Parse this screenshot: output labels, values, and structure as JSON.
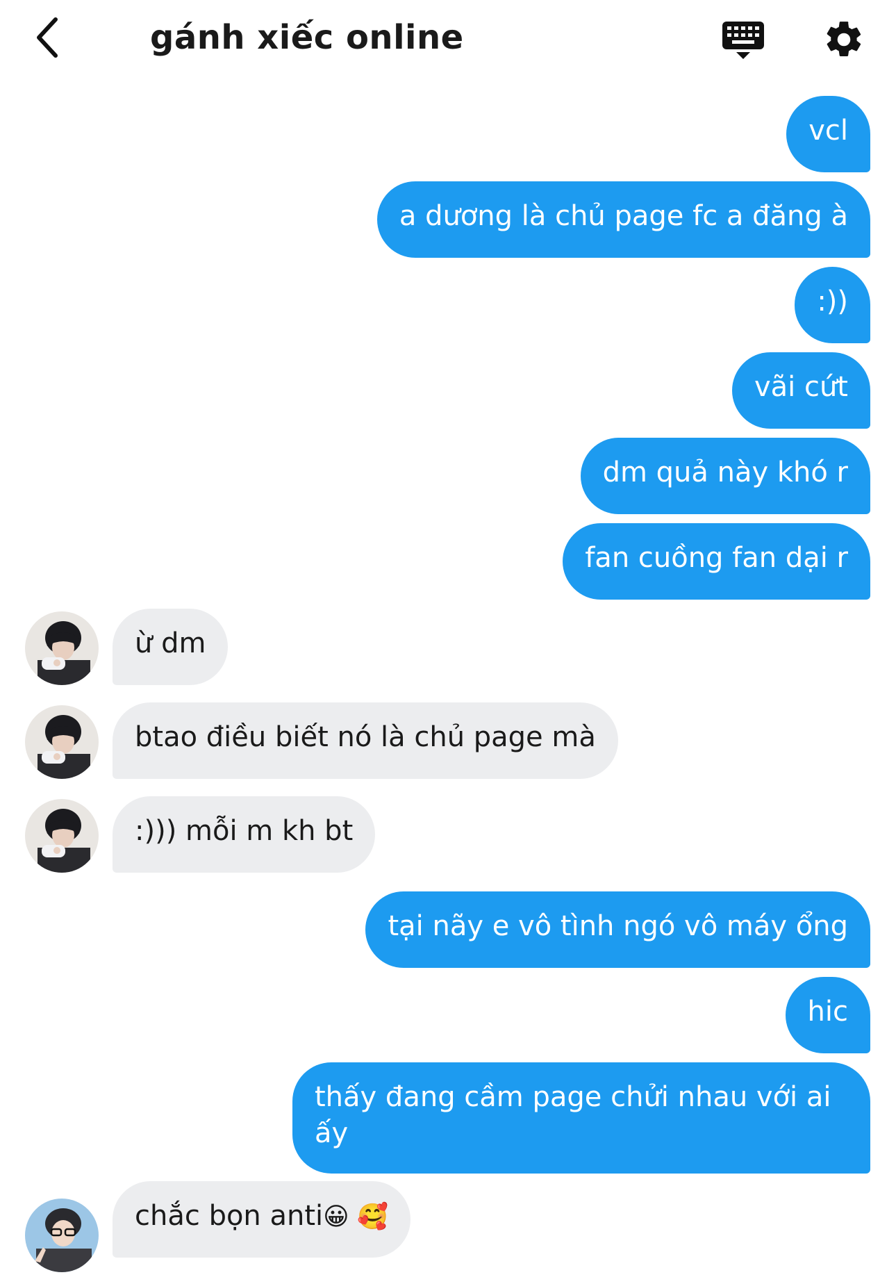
{
  "header": {
    "title": "gánh xiếc online",
    "back_icon": "chevron-left-icon",
    "keyboard_icon": "keyboard-icon",
    "settings_icon": "gear-icon"
  },
  "colors": {
    "outgoing_bubble": "#1d9bf0",
    "incoming_bubble": "#ecedef",
    "outgoing_text": "#ffffff",
    "incoming_text": "#1a1a1a"
  },
  "messages": [
    {
      "from": "me",
      "text": "vcl"
    },
    {
      "from": "me",
      "text": "a dương là chủ page fc a đăng à"
    },
    {
      "from": "me",
      "text": ":))"
    },
    {
      "from": "me",
      "text": "vãi cứt"
    },
    {
      "from": "me",
      "text": "dm quả này khó r"
    },
    {
      "from": "me",
      "text": "fan cuồng fan dại r"
    },
    {
      "from": "other",
      "text": "ừ dm"
    },
    {
      "from": "other",
      "text": "btao điều biết nó là chủ page mà"
    },
    {
      "from": "other",
      "text": ":))) mỗi m kh bt"
    },
    {
      "from": "me",
      "text": "tại nãy e vô tình ngó vô máy ổng"
    },
    {
      "from": "me",
      "text": "hic"
    },
    {
      "from": "me",
      "text": "thấy đang cầm page chửi nhau với ai ấy"
    },
    {
      "from": "other2",
      "text": "chắc bọn anti",
      "emojis": "😀 🥰"
    }
  ]
}
